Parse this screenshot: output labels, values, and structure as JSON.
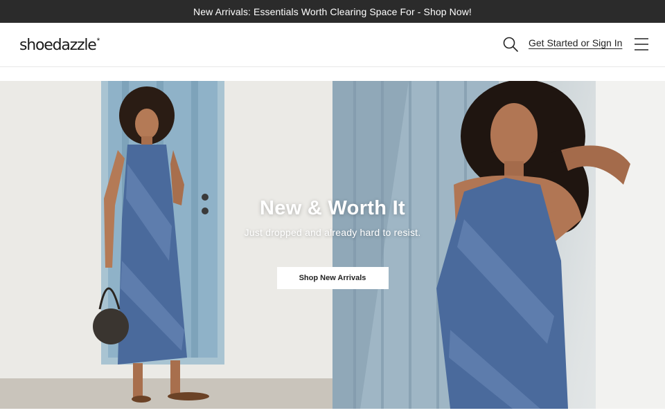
{
  "promo_bar": {
    "text": "New Arrivals: Essentials Worth Clearing Space For - Shop Now!"
  },
  "header": {
    "logo_text": "shoedazzle",
    "logo_mark": "*",
    "search_icon": "search-icon",
    "signin_label": "Get Started or Sign In",
    "menu_icon": "hamburger-menu-icon"
  },
  "hero": {
    "title": "New & Worth It",
    "subtitle": "Just dropped and already hard to resist.",
    "cta_label": "Shop New Arrivals"
  },
  "colors": {
    "promo_bg": "#2b2b2b",
    "promo_text": "#ffffff",
    "dress_blue": "#4a6a9c",
    "door_blue": "#8fb2c8"
  }
}
